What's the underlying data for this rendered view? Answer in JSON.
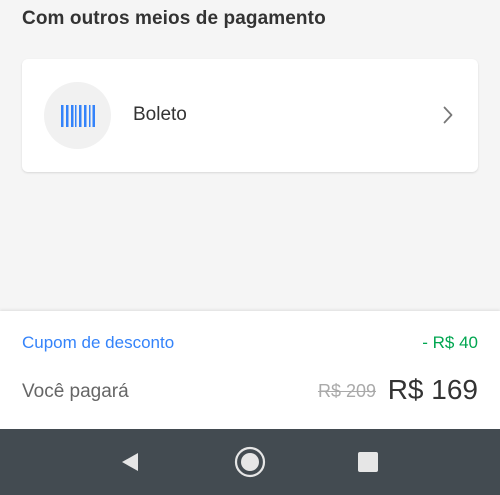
{
  "section": {
    "title": "Com outros meios de pagamento"
  },
  "payment_methods": [
    {
      "label": "Boleto",
      "icon": "barcode-icon"
    }
  ],
  "summary": {
    "coupon_label": "Cupom de desconto",
    "coupon_value": "- R$ 40",
    "total_label": "Você pagará",
    "old_price": "R$ 209",
    "new_price": "R$ 169"
  },
  "colors": {
    "background": "#f5f5f5",
    "link_blue": "#3483fa",
    "discount_green": "#00a650",
    "navbar": "#434b51",
    "icon_blue": "#3483fa"
  },
  "navbar": {
    "buttons": [
      "back-icon",
      "home-icon",
      "recents-icon"
    ]
  }
}
